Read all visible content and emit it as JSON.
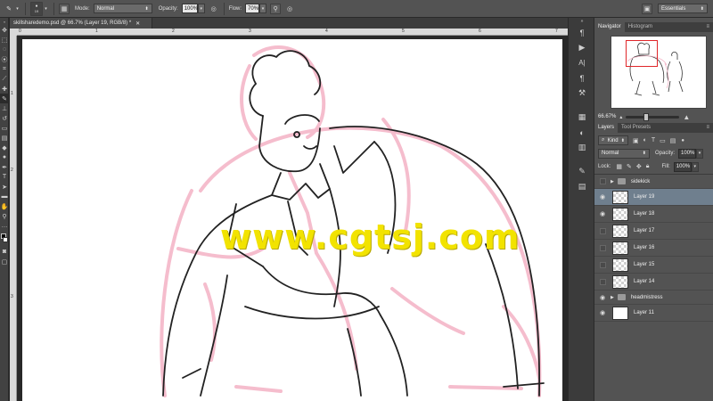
{
  "options_bar": {
    "brush_size": "19",
    "mode_label": "Mode:",
    "mode_value": "Normal",
    "opacity_label": "Opacity:",
    "opacity_value": "100%",
    "flow_label": "Flow:",
    "flow_value": "70%",
    "workspace": "Essentials"
  },
  "document": {
    "tab_title": "skillsharedemo.psd @ 66.7% (Layer 19, RGB/8) *",
    "ruler_top": [
      "0",
      "1",
      "2",
      "3",
      "4",
      "5",
      "6",
      "7"
    ],
    "ruler_left": [
      "1",
      "2",
      "3"
    ],
    "watermark": "www.cgtsj.com"
  },
  "navigator": {
    "tabs": [
      "Navigator",
      "Histogram"
    ],
    "zoom": "66.67%"
  },
  "layers": {
    "tabs": [
      "Layers",
      "Tool Presets"
    ],
    "kind_label": "Kind",
    "blend_mode": "Normal",
    "opacity_label": "Opacity:",
    "opacity_value": "100%",
    "lock_label": "Lock:",
    "fill_label": "Fill:",
    "fill_value": "100%",
    "items": [
      {
        "name": "sidekick",
        "type": "group",
        "visible": false,
        "selected": false
      },
      {
        "name": "Layer 19",
        "type": "layer",
        "visible": true,
        "selected": true
      },
      {
        "name": "Layer 18",
        "type": "layer",
        "visible": true,
        "selected": false
      },
      {
        "name": "Layer 17",
        "type": "layer",
        "visible": false,
        "selected": false
      },
      {
        "name": "Layer 16",
        "type": "layer",
        "visible": false,
        "selected": false
      },
      {
        "name": "Layer 15",
        "type": "layer",
        "visible": false,
        "selected": false
      },
      {
        "name": "Layer 14",
        "type": "layer",
        "visible": false,
        "selected": false
      },
      {
        "name": "headmistress",
        "type": "group",
        "visible": true,
        "selected": false
      },
      {
        "name": "Layer 11",
        "type": "layer",
        "visible": true,
        "selected": false
      }
    ]
  },
  "colors": {
    "canvas": "#ffffff",
    "sketch_pink": "#f4b6c8",
    "ink": "#222222",
    "watermark": "#f2e300",
    "selection": "#6f7f8e",
    "nav_frame": "#e0262a"
  }
}
